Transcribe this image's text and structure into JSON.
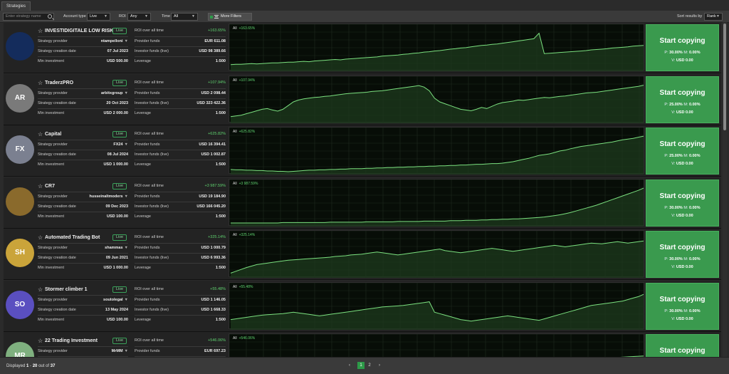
{
  "tabs": [
    "Strategies"
  ],
  "filters": {
    "search_placeholder": "Enter strategy name",
    "account_type_label": "Account type",
    "account_type_value": "Live",
    "roi_label": "ROI",
    "roi_value": "Any",
    "time_label": "Time",
    "time_value": "All",
    "more_filters_label": "More Filters",
    "sort_label": "Sort results by",
    "sort_value": "Rank"
  },
  "labels": {
    "live": "Live",
    "provider": "Strategy provider",
    "creation_date": "Strategy creation date",
    "min_investment": "Min investment",
    "roi_all_time": "ROI over all time",
    "provider_funds": "Provider funds",
    "investor_funds": "Investor funds (live)",
    "leverage": "Leverage",
    "chart_period": "All",
    "start_copying": "Start copying",
    "p_label": "P:",
    "m_label": "M:",
    "v_label": "V:"
  },
  "strategies": [
    {
      "name": "INVESTIDIGITALE LOW RISK",
      "provider": "ntampelloni",
      "creation_date": "07 Jul 2023",
      "min_investment": "USD 500.00",
      "roi": "+163.65%",
      "provider_funds": "EUR 611.08",
      "investor_funds": "USD 98 389.66",
      "leverage": "1:500",
      "avatar_text": "",
      "avatar_color": "#142c5c",
      "p": "30.00%",
      "m": "0.00%",
      "v": "USD 0.00",
      "chart": [
        10,
        11,
        11,
        12,
        13,
        12,
        13,
        14,
        15,
        15,
        16,
        17,
        17,
        18,
        19,
        18,
        20,
        21,
        22,
        23,
        24,
        23,
        25,
        26,
        27,
        28,
        29,
        30,
        31,
        33,
        34,
        35,
        36,
        38,
        39,
        41,
        42,
        44,
        45,
        47,
        48,
        50,
        52,
        53,
        55,
        56,
        58,
        60,
        62,
        63,
        65,
        66,
        68,
        70,
        72,
        74,
        76,
        78,
        80,
        95,
        40,
        41,
        42,
        43,
        44,
        45,
        46,
        47,
        48,
        50,
        51,
        52,
        53,
        55,
        56,
        57,
        58,
        60,
        61,
        62
      ]
    },
    {
      "name": "TraderzPRO",
      "provider": "arbitxgroup",
      "creation_date": "20 Oct 2023",
      "min_investment": "USD 2 000.00",
      "roi": "+107.94%",
      "provider_funds": "USD 2 098.44",
      "investor_funds": "USD 323 422.36",
      "leverage": "1:500",
      "avatar_text": "AR",
      "avatar_color": "#7a7a7a",
      "p": "25.00%",
      "m": "0.00%",
      "v": "USD 0.00",
      "chart": [
        10,
        12,
        14,
        18,
        22,
        26,
        30,
        32,
        28,
        25,
        30,
        40,
        50,
        55,
        58,
        60,
        62,
        63,
        65,
        66,
        68,
        70,
        72,
        73,
        74,
        75,
        76,
        78,
        79,
        80,
        82,
        84,
        86,
        88,
        90,
        92,
        94,
        90,
        80,
        60,
        50,
        45,
        40,
        35,
        30,
        28,
        26,
        30,
        35,
        32,
        38,
        44,
        48,
        50,
        52,
        55,
        54,
        56,
        58,
        60,
        62,
        61,
        63,
        65,
        66,
        68,
        70,
        72,
        74,
        75,
        76,
        78,
        80,
        82,
        84,
        86,
        88,
        90,
        92,
        95
      ]
    },
    {
      "name": "Capital",
      "provider": "FX24",
      "creation_date": "08 Jul 2024",
      "min_investment": "USD 1 000.00",
      "roi": "+625.82%",
      "provider_funds": "USD 16 394.41",
      "investor_funds": "USD 1 002.87",
      "leverage": "1:500",
      "avatar_text": "FX",
      "avatar_color": "#7b8090",
      "p": "25.00%",
      "m": "0.00%",
      "v": "USD 0.00",
      "chart": [
        6,
        5,
        5,
        4,
        4,
        3,
        3,
        2,
        2,
        1,
        1,
        0,
        1,
        2,
        3,
        4,
        4,
        5,
        5,
        6,
        6,
        7,
        7,
        8,
        8,
        8,
        9,
        9,
        10,
        10,
        11,
        11,
        12,
        12,
        13,
        13,
        14,
        14,
        15,
        15,
        16,
        16,
        17,
        17,
        18,
        18,
        19,
        20,
        20,
        21,
        22,
        22,
        23,
        25,
        27,
        30,
        33,
        36,
        40,
        44,
        46,
        48,
        52,
        56,
        58,
        62,
        65,
        68,
        70,
        72,
        74,
        76,
        78,
        80,
        83,
        86,
        88,
        90,
        93,
        96
      ]
    },
    {
      "name": "CR7",
      "provider": "husseinaltmoders",
      "creation_date": "09 Dec 2023",
      "min_investment": "USD 100.00",
      "roi": "+3 987.59%",
      "provider_funds": "USD 19 184.90",
      "investor_funds": "USD 166 045.20",
      "leverage": "1:500",
      "avatar_text": "",
      "avatar_color": "#8a6a2c",
      "p": "30.00%",
      "m": "0.00%",
      "v": "USD 0.00",
      "chart": [
        2,
        2,
        2,
        2,
        2,
        2,
        2,
        2,
        2,
        2,
        3,
        3,
        3,
        3,
        3,
        3,
        3,
        3,
        3,
        4,
        4,
        4,
        4,
        4,
        4,
        4,
        5,
        5,
        5,
        5,
        5,
        5,
        6,
        6,
        6,
        6,
        6,
        7,
        7,
        7,
        7,
        7,
        8,
        8,
        8,
        9,
        9,
        9,
        10,
        10,
        11,
        11,
        12,
        12,
        13,
        13,
        14,
        15,
        16,
        17,
        18,
        20,
        22,
        24,
        27,
        30,
        34,
        38,
        42,
        46,
        50,
        55,
        60,
        65,
        70,
        75,
        80,
        85,
        90,
        96
      ]
    },
    {
      "name": "Automated Trading Bot",
      "provider": "shammas",
      "creation_date": "09 Jun 2021",
      "min_investment": "USD 1 000.00",
      "roi": "+325.14%",
      "provider_funds": "USD 1 000.79",
      "investor_funds": "USD 6 993.36",
      "leverage": "1:500",
      "avatar_text": "SH",
      "avatar_color": "#caa43a",
      "p": "30.00%",
      "m": "0.00%",
      "v": "USD 0.00",
      "chart": [
        5,
        10,
        15,
        20,
        24,
        28,
        30,
        32,
        34,
        36,
        38,
        40,
        41,
        42,
        43,
        44,
        45,
        46,
        47,
        48,
        50,
        51,
        52,
        54,
        55,
        56,
        58,
        60,
        62,
        60,
        58,
        56,
        54,
        56,
        58,
        60,
        62,
        64,
        66,
        68,
        70,
        66,
        64,
        62,
        60,
        62,
        64,
        66,
        68,
        70,
        72,
        70,
        68,
        66,
        64,
        66,
        68,
        70,
        72,
        74,
        76,
        78,
        80,
        78,
        76,
        78,
        80,
        82,
        84,
        86,
        85,
        84,
        86,
        88,
        90,
        88,
        86,
        88,
        90,
        92
      ]
    },
    {
      "name": "Stormer climber 1",
      "provider": "soutolegal",
      "creation_date": "13 May 2024",
      "min_investment": "USD 100.00",
      "roi": "+55.48%",
      "provider_funds": "USD 1 146.05",
      "investor_funds": "USD 1 668.33",
      "leverage": "1:500",
      "avatar_text": "SO",
      "avatar_color": "#5a4fc0",
      "p": "30.00%",
      "m": "0.00%",
      "v": "USD 0.00",
      "chart": [
        20,
        22,
        24,
        26,
        28,
        30,
        32,
        33,
        34,
        35,
        36,
        38,
        40,
        38,
        36,
        34,
        32,
        30,
        32,
        34,
        36,
        38,
        40,
        42,
        44,
        46,
        48,
        50,
        52,
        54,
        55,
        56,
        57,
        58,
        60,
        62,
        64,
        66,
        68,
        40,
        36,
        32,
        28,
        24,
        20,
        18,
        16,
        18,
        20,
        22,
        24,
        26,
        28,
        30,
        28,
        26,
        24,
        22,
        20,
        18,
        22,
        26,
        30,
        34,
        38,
        42,
        46,
        50,
        54,
        58,
        60,
        62,
        64,
        66,
        68,
        70,
        74,
        78,
        82,
        88
      ]
    },
    {
      "name": "22 Trading Investment",
      "provider": "MrMM",
      "creation_date": "",
      "min_investment": "",
      "roi": "+546.06%",
      "provider_funds": "EUR 697.23",
      "investor_funds": "",
      "leverage": "",
      "avatar_text": "MR",
      "avatar_color": "#7fb07f",
      "p": "",
      "m": "",
      "v": "",
      "chart": [
        5,
        6,
        7,
        8,
        10,
        12,
        14,
        16,
        18,
        20,
        22,
        24,
        26,
        28,
        30,
        32,
        34,
        36,
        38,
        40,
        42,
        44,
        46,
        48,
        50,
        52,
        54,
        56,
        58,
        60
      ]
    }
  ],
  "footer": {
    "displayed_label": "Displayed",
    "range_start": "1",
    "range_sep": "-",
    "range_end": "20",
    "out_of": "out of",
    "total": "37",
    "prev": "‹",
    "pages": [
      "1",
      "2"
    ],
    "next": "›"
  },
  "colors": {
    "accent_green": "#3a9a4e",
    "roi_green": "#5fd26f",
    "chart_line": "#7be07f",
    "chart_bg": "#070d07"
  }
}
